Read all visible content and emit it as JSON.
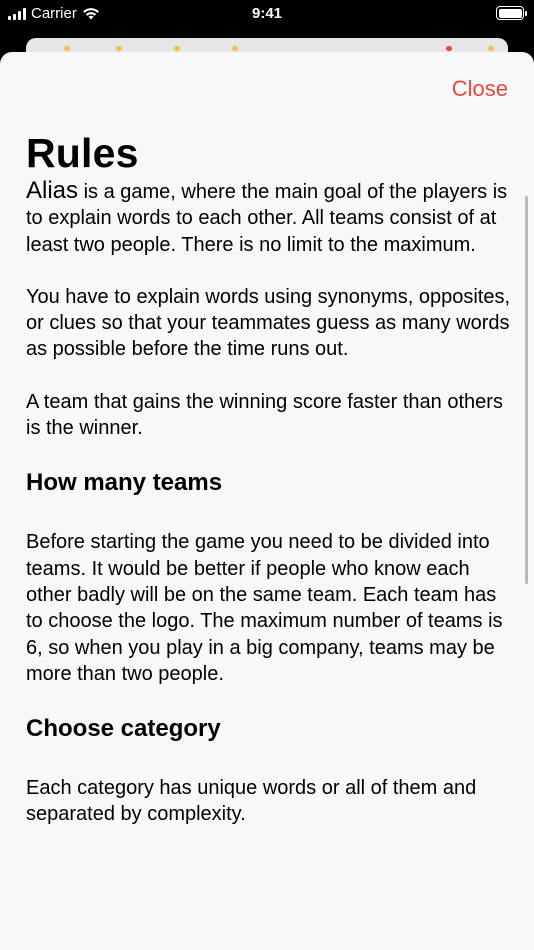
{
  "status_bar": {
    "carrier": "Carrier",
    "time": "9:41"
  },
  "header": {
    "close_label": "Close",
    "title": "Rules"
  },
  "content": {
    "intro_lead": "Alias",
    "intro_rest": " is a game, where the main goal of the players is to explain words to each other. All teams consist of at least two people. There is no limit to the maximum.",
    "para_2": "You have to explain words using synonyms, opposites, or clues so that your teammates guess as many words as possible before the time runs out.",
    "para_3": "A team that gains the winning score faster than others is the winner.",
    "heading_teams": "How many teams",
    "para_teams": "Before starting the game you need to be divided into teams. It would be better if people who know each other badly will be on the same team. Each team has to choose the logo. The maximum number of teams is 6, so when you play in a big company, teams may be more than two people.",
    "heading_category": "Choose category",
    "para_category": "Each category has unique words or all of them and separated by complexity."
  },
  "colors": {
    "accent": "#e8473a",
    "sheet_bg": "#f8f8fb"
  }
}
